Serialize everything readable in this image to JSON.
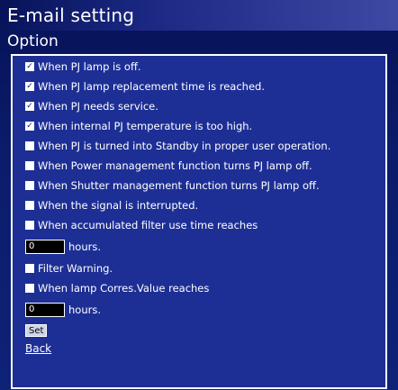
{
  "header": {
    "title": "E-mail setting",
    "subtitle": "Option"
  },
  "options": [
    {
      "label": "When PJ lamp is off.",
      "checked": true
    },
    {
      "label": "When PJ lamp replacement time is reached.",
      "checked": true
    },
    {
      "label": "When PJ needs service.",
      "checked": true
    },
    {
      "label": "When internal PJ temperature is too high.",
      "checked": true
    },
    {
      "label": "When PJ is turned into Standby in proper user operation.",
      "checked": false
    },
    {
      "label": "When Power management function turns PJ lamp off.",
      "checked": false
    },
    {
      "label": "When Shutter management function turns PJ lamp off.",
      "checked": false
    },
    {
      "label": "When the signal is interrupted.",
      "checked": false
    },
    {
      "label": "When accumulated filter use time reaches",
      "checked": false
    }
  ],
  "filter_hours": {
    "value": "0",
    "unit": "hours."
  },
  "filter_warning": {
    "label": "Filter Warning.",
    "checked": false
  },
  "lamp_value": {
    "label": "When lamp Corres.Value reaches",
    "checked": false
  },
  "lamp_hours": {
    "value": "0",
    "unit": "hours."
  },
  "actions": {
    "set_label": "Set",
    "back_label": "Back"
  },
  "colors": {
    "background": "#0c1b66",
    "panel": "#1d2f95",
    "text": "#ffffff"
  }
}
